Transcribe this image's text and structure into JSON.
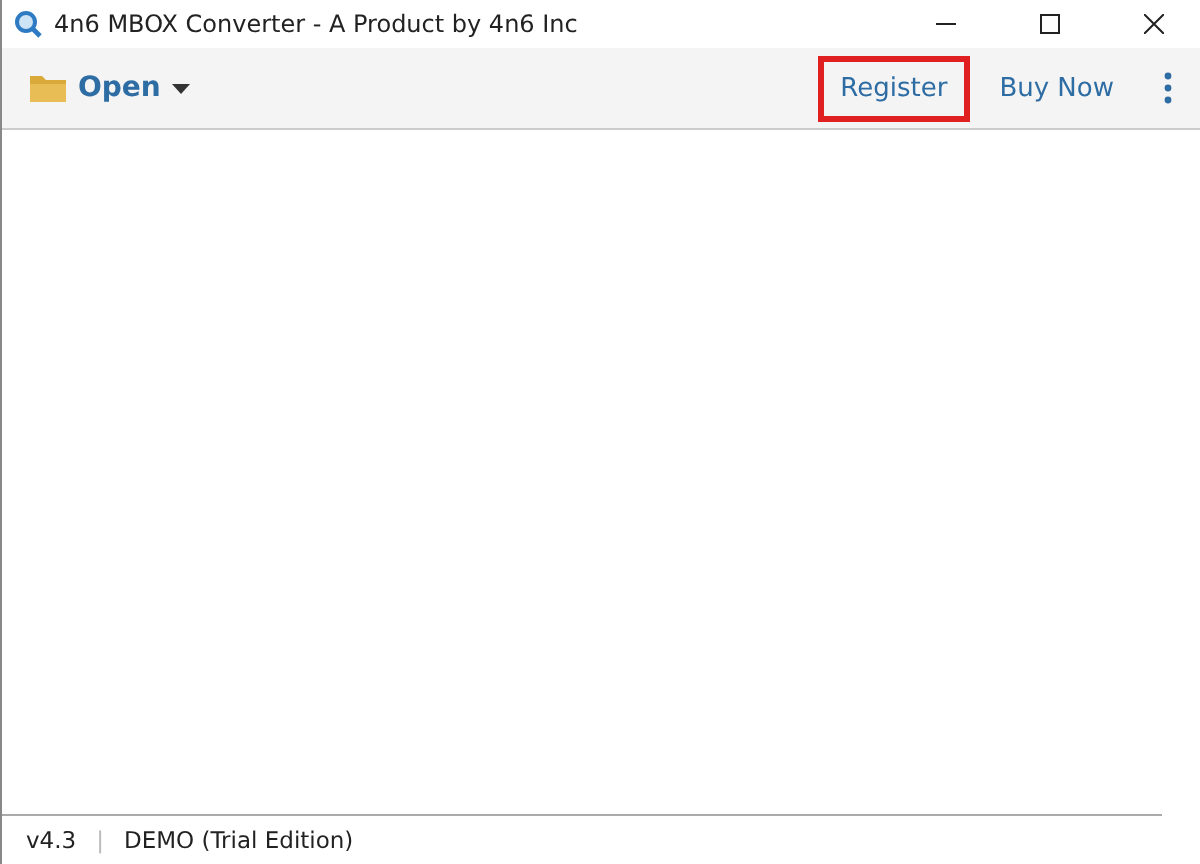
{
  "window": {
    "title": "4n6 MBOX Converter - A Product by 4n6 Inc"
  },
  "toolbar": {
    "open_button": {
      "label": "Open"
    },
    "actions": [
      {
        "label": "Register",
        "highlighted": true
      },
      {
        "label": "Buy Now",
        "highlighted": false
      }
    ]
  },
  "status_bar": {
    "version": "v4.3",
    "separator": "|",
    "edition": "DEMO (Trial Edition)"
  }
}
